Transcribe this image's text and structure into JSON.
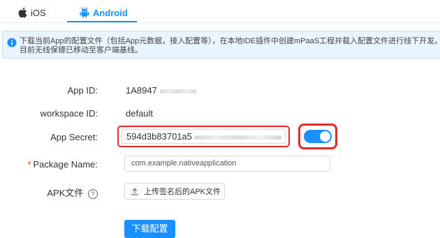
{
  "tabs": [
    {
      "label": "iOS",
      "icon": "apple-icon",
      "active": false
    },
    {
      "label": "Android",
      "icon": "android-icon",
      "active": true
    }
  ],
  "colors": {
    "accent": "#1890ff",
    "highlight": "#e02b27",
    "alert_bg": "#e9f4ff",
    "required": "#f5222d"
  },
  "alert": {
    "icon": "info-icon",
    "text": "下载当前App的配置文件（包括App元数据，接入配置等），在本地IDE插件中创建mPaaS工程并载入配置文件进行线下开发。目前无线保镖已移动至客户端基线。"
  },
  "form": {
    "app_id": {
      "label": "App ID:",
      "value": "1A8947"
    },
    "workspace_id": {
      "label": "workspace ID:",
      "value": "default"
    },
    "app_secret": {
      "label": "App Secret:",
      "value": "594d3b83701a5",
      "toggle_on": true
    },
    "package_name": {
      "label": "Package Name:",
      "required_mark": "*",
      "value": "com.example.nativeapplication"
    },
    "apk_file": {
      "label": "APK文件",
      "help_icon": "question-circle-icon",
      "help_glyph": "?",
      "upload_label": "上传签名后的APK文件",
      "upload_icon": "upload-icon"
    }
  },
  "download_button": "下载配置"
}
